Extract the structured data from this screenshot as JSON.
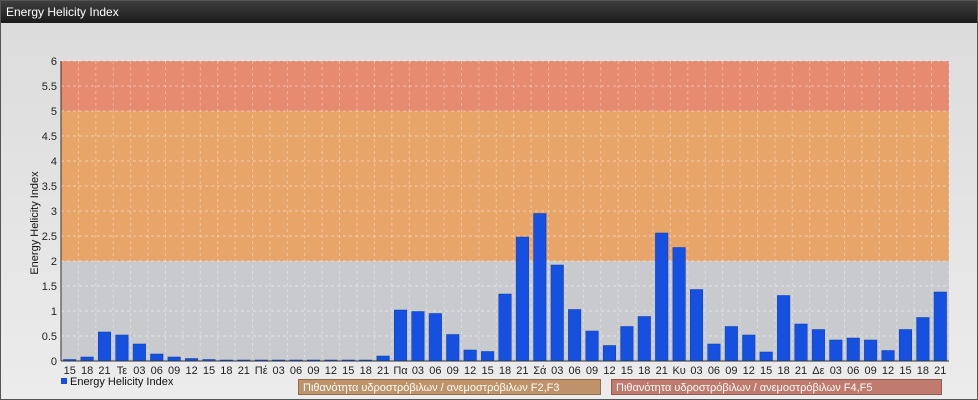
{
  "window": {
    "title": "Energy Helicity Index"
  },
  "zones": {
    "f23_label": "Πιθανότητα υδροστρόβιλων / ανεμοστρόβιλων F2,F3",
    "f45_label": "Πιθανότητα υδροστρόβιλων / ανεμοστρόβιλων F4,F5",
    "f23_color": "#c0926a",
    "f45_color": "#c07a6e"
  },
  "chart_data": {
    "type": "bar",
    "title": "",
    "xlabel": "",
    "ylabel": "Energy Helicity Index",
    "ylim": [
      0,
      6
    ],
    "yticks": [
      "0",
      "0.5",
      "1",
      "1.5",
      "2",
      "2.5",
      "3",
      "3.5",
      "4",
      "4.5",
      "5",
      "5.5",
      "6"
    ],
    "grid": true,
    "legend_position": "bottom-left",
    "bands": [
      {
        "from": 0,
        "to": 2,
        "color": "#c8cacd"
      },
      {
        "from": 2,
        "to": 5,
        "color": "#e8a56a"
      },
      {
        "from": 5,
        "to": 6,
        "color": "#e68a70"
      }
    ],
    "categories": [
      "15",
      "18",
      "21",
      "Τε",
      "03",
      "06",
      "09",
      "12",
      "15",
      "18",
      "21",
      "Πέ",
      "03",
      "06",
      "09",
      "12",
      "15",
      "18",
      "21",
      "Πα",
      "03",
      "06",
      "09",
      "12",
      "15",
      "18",
      "21",
      "Σά",
      "03",
      "06",
      "09",
      "12",
      "15",
      "18",
      "21",
      "Κυ",
      "03",
      "06",
      "09",
      "12",
      "15",
      "18",
      "21",
      "Δε",
      "03",
      "06",
      "09",
      "12",
      "15",
      "18",
      "21"
    ],
    "series": [
      {
        "name": "Energy Helicity Index",
        "color": "#1650e0",
        "values": [
          0.03,
          0.08,
          0.58,
          0.52,
          0.34,
          0.14,
          0.08,
          0.05,
          0.03,
          0.02,
          0.02,
          0.02,
          0.02,
          0.02,
          0.02,
          0.02,
          0.02,
          0.02,
          0.1,
          1.02,
          0.99,
          0.95,
          0.53,
          0.22,
          0.19,
          1.34,
          2.48,
          2.95,
          1.92,
          1.03,
          0.6,
          0.31,
          0.69,
          0.89,
          2.56,
          2.27,
          1.43,
          0.34,
          0.69,
          0.52,
          0.18,
          1.31,
          0.74,
          0.63,
          0.42,
          0.46,
          0.42,
          0.21,
          0.63,
          0.87,
          1.38
        ]
      }
    ]
  }
}
